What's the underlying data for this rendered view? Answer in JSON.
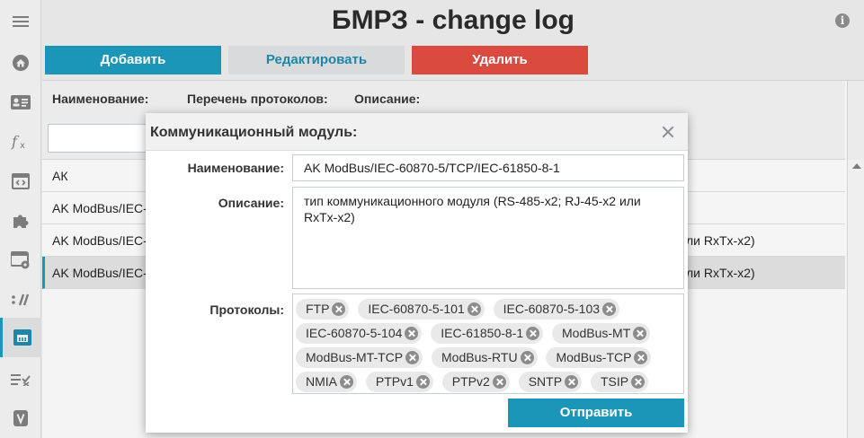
{
  "header": {
    "title": "БМРЗ - change log",
    "info_icon": "info-icon",
    "menu_icon": "hamburger-icon"
  },
  "sidebar": {
    "items": [
      {
        "icon": "home-icon"
      },
      {
        "icon": "id-card-icon"
      },
      {
        "icon": "function-icon"
      },
      {
        "icon": "code-window-icon"
      },
      {
        "icon": "puzzle-icon"
      },
      {
        "icon": "window-settings-icon"
      },
      {
        "icon": "slashes-icon"
      },
      {
        "icon": "ethernet-module-icon",
        "active": true
      },
      {
        "icon": "checklist-icon"
      },
      {
        "icon": "version-badge-icon"
      }
    ]
  },
  "toolbar": {
    "add_label": "Добавить",
    "edit_label": "Редактировать",
    "delete_label": "Удалить"
  },
  "table": {
    "headers": {
      "name": "Наименование:",
      "protocols": "Перечень протоколов:",
      "description": "Описание:"
    },
    "rows": [
      {
        "name": "АК",
        "tail": ""
      },
      {
        "name": "AK ModBus/IEC-",
        "tail": ""
      },
      {
        "name": "AK ModBus/IEC-",
        "tail": "ли RxTx-x2)"
      },
      {
        "name": "AK ModBus/IEC-",
        "tail": "ли RxTx-x2)",
        "selected": true
      }
    ]
  },
  "modal": {
    "title": "Коммуникационный модуль:",
    "name_label": "Наименование:",
    "name_value": "AK ModBus/IEC-60870-5/TCP/IEC-61850-8-1",
    "description_label": "Описание:",
    "description_value": "тип коммуникационного модуля (RS-485-x2; RJ-45-x2 или RxTx-x2)",
    "protocols_label": "Протоколы:",
    "protocol_rows": [
      [
        "FTP",
        "IEC-60870-5-101",
        "IEC-60870-5-103"
      ],
      [
        "IEC-60870-5-104",
        "IEC-61850-8-1",
        "ModBus-MT"
      ],
      [
        "ModBus-MT-TCP",
        "ModBus-RTU",
        "ModBus-TCP"
      ],
      [
        "NMIA",
        "PTPv1",
        "PTPv2",
        "SNTP",
        "TSIP"
      ]
    ],
    "submit_label": "Отправить"
  },
  "colors": {
    "accent": "#1c96b8",
    "danger": "#db4a3f",
    "secondary": "#d9dadc"
  }
}
